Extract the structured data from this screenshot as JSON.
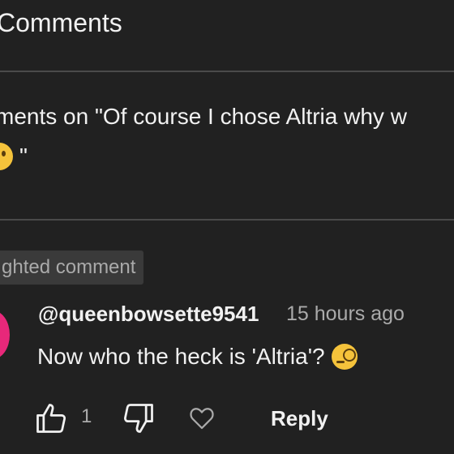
{
  "header": {
    "title": "Comments"
  },
  "context": {
    "line1": "ments on \"Of course I chose Altria why w",
    "line2": " \""
  },
  "highlight": {
    "badge": "ghted comment"
  },
  "comment": {
    "author": "@queenbowsette9541",
    "time": "15 hours ago",
    "text": "Now who the heck is 'Altria'?",
    "like_count": "1",
    "reply_label": "Reply"
  },
  "icons": {
    "like": "thumbs-up-icon",
    "dislike": "thumbs-down-icon",
    "heart": "heart-icon",
    "emoji_context": "face-with-raised-eyebrow-emoji",
    "emoji_comment": "dizzy-face-emoji"
  },
  "colors": {
    "background": "#212121",
    "text": "#f1f1f1",
    "secondary_text": "#aaaaaa",
    "avatar": "#e8287a",
    "emoji": "#f5c33b"
  }
}
